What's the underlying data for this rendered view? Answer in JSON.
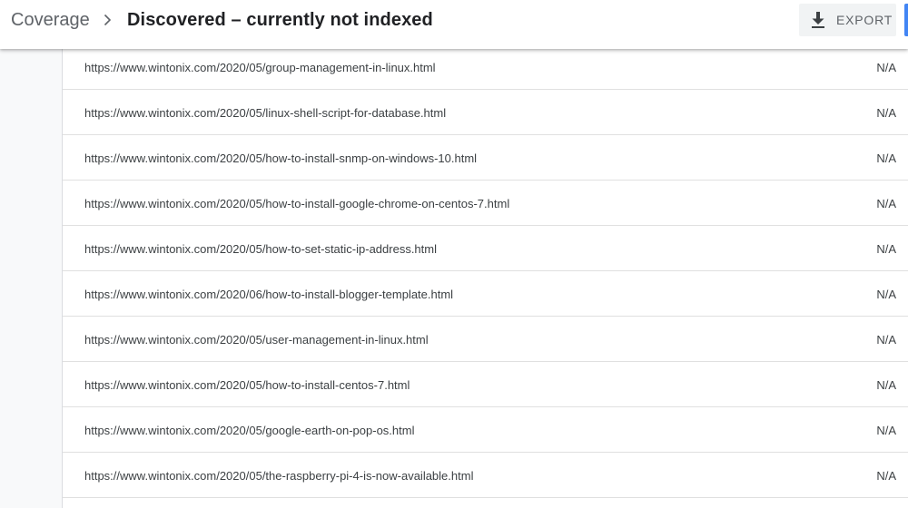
{
  "header": {
    "breadcrumb_root": "Coverage",
    "title": "Discovered – currently not indexed",
    "export_label": "EXPORT",
    "icons": {
      "separator": "chevron-right-icon",
      "export": "download-icon"
    }
  },
  "colors": {
    "accent": "#4285f4",
    "text_primary": "#202124",
    "text_secondary": "#5f6368",
    "row_divider": "#e0e0e0"
  },
  "rows": [
    {
      "url": "https://www.wintonix.com/2020/05/group-management-in-linux.html",
      "last_crawled": "N/A"
    },
    {
      "url": "https://www.wintonix.com/2020/05/linux-shell-script-for-database.html",
      "last_crawled": "N/A"
    },
    {
      "url": "https://www.wintonix.com/2020/05/how-to-install-snmp-on-windows-10.html",
      "last_crawled": "N/A"
    },
    {
      "url": "https://www.wintonix.com/2020/05/how-to-install-google-chrome-on-centos-7.html",
      "last_crawled": "N/A"
    },
    {
      "url": "https://www.wintonix.com/2020/05/how-to-set-static-ip-address.html",
      "last_crawled": "N/A"
    },
    {
      "url": "https://www.wintonix.com/2020/06/how-to-install-blogger-template.html",
      "last_crawled": "N/A"
    },
    {
      "url": "https://www.wintonix.com/2020/05/user-management-in-linux.html",
      "last_crawled": "N/A"
    },
    {
      "url": "https://www.wintonix.com/2020/05/how-to-install-centos-7.html",
      "last_crawled": "N/A"
    },
    {
      "url": "https://www.wintonix.com/2020/05/google-earth-on-pop-os.html",
      "last_crawled": "N/A"
    },
    {
      "url": "https://www.wintonix.com/2020/05/the-raspberry-pi-4-is-now-available.html",
      "last_crawled": "N/A"
    }
  ]
}
